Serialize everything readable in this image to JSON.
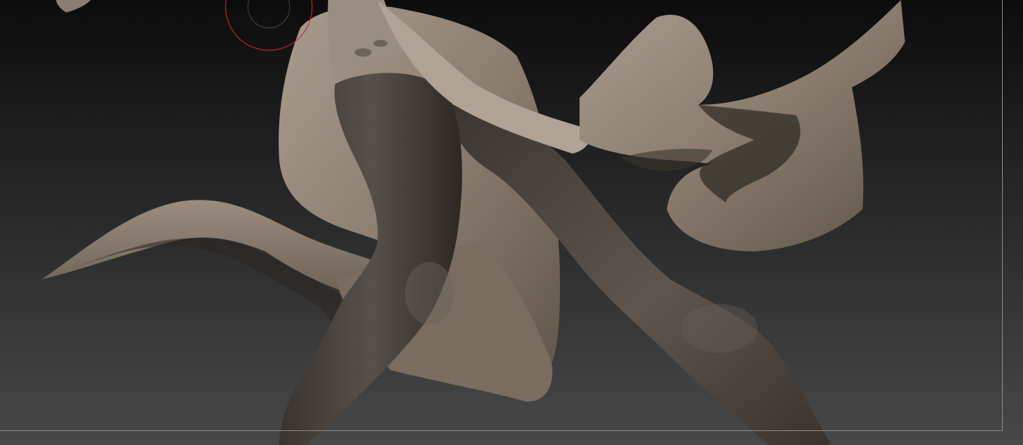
{
  "viewport": {
    "background_top": "#0c0c0c",
    "background_bottom": "#484848",
    "document_frame_color": "#8e8e8e"
  },
  "brush_cursor": {
    "icon": "brush-cursor-icon",
    "color": "#c2272d"
  },
  "model": {
    "material": "clay",
    "skin_color": "#4a423c",
    "cloth_color": "#8a7c6e",
    "cloth_highlight": "#aa9d90"
  }
}
